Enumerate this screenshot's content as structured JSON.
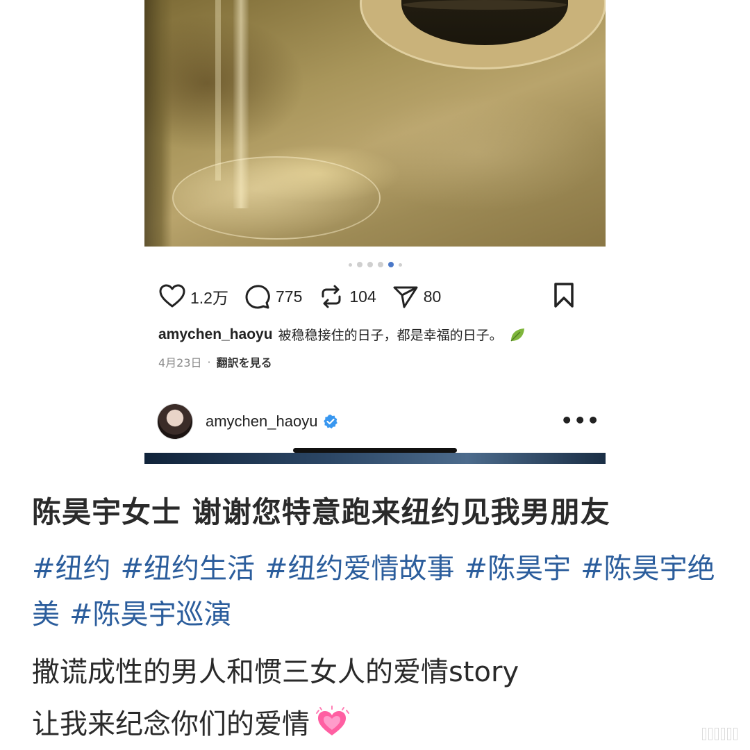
{
  "post": {
    "likes": "1.2万",
    "comments": "775",
    "reposts": "104",
    "shares": "80",
    "username": "amychen_haoyu",
    "caption": "被稳稳接住的日子，都是幸福的日子。",
    "date": "4月23日",
    "separator": "·",
    "translate": "翻訳を見る",
    "carousel": {
      "count": 6,
      "active_index": 4
    }
  },
  "next_post": {
    "username": "amychen_haoyu",
    "more": "•••"
  },
  "text_post": {
    "title": "陈昊宇女士 谢谢您特意跑来纽约见我男朋友",
    "tags": [
      "#纽约",
      "#纽约生活",
      "#纽约爱情故事",
      "#陈昊宇",
      "#陈昊宇绝美",
      "#陈昊宇巡演"
    ],
    "line1": "撒谎成性的男人和惯三女人的爱情story",
    "line2": "让我来纪念你们的爱情"
  },
  "colors": {
    "hashtag": "#2b5d9c",
    "verified": "#3897f0",
    "active_dot": "#4a78c8",
    "heart": "#ff4f9a"
  },
  "icons": [
    "heart-icon",
    "comment-icon",
    "repost-icon",
    "share-icon",
    "bookmark-icon",
    "verified-icon",
    "leaf-icon",
    "sparkling-heart-icon",
    "more-icon"
  ]
}
